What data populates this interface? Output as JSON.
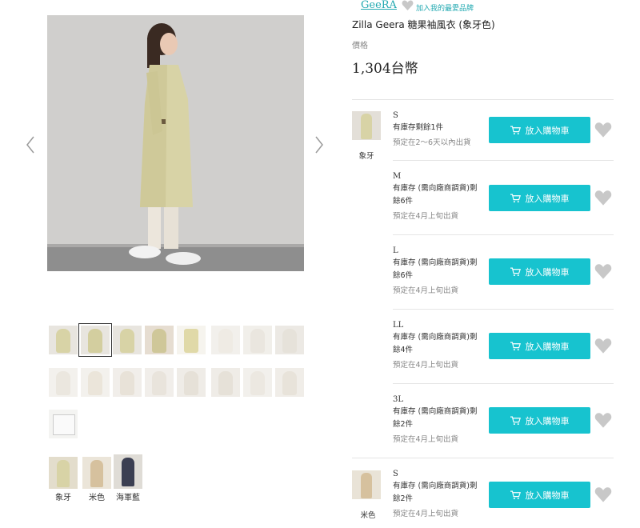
{
  "product": {
    "brand": "GeeRA",
    "favorite_text": "加入我的最愛品牌",
    "title": "Zilla Geera 糖果袖風衣 (象牙色)",
    "price_label": "價格",
    "price": "1,304台幣"
  },
  "gallery": {
    "prev_icon": "chevron-left-icon",
    "next_icon": "chevron-right-icon",
    "thumbnail_count": 17,
    "selected_thumbnail": 2
  },
  "colors": [
    {
      "label": "象牙",
      "swatch": "#e9e2c9"
    },
    {
      "label": "米色",
      "swatch": "#dcc8a6"
    },
    {
      "label": "海軍藍",
      "swatch": "#3b3f52"
    }
  ],
  "variants": [
    {
      "color": "象牙",
      "size": "S",
      "stock_line1": "有庫存剩餘1件",
      "stock_line2": "",
      "shipping": "預定在2～6天以內出貨",
      "button": "放入購物車"
    },
    {
      "color": "",
      "size": "M",
      "stock_line1": "有庫存 (需向廠商調貨)剩",
      "stock_line2": "餘6件",
      "shipping": "預定在4月上旬出貨",
      "button": "放入購物車"
    },
    {
      "color": "",
      "size": "L",
      "stock_line1": "有庫存 (需向廠商調貨)剩",
      "stock_line2": "餘6件",
      "shipping": "預定在4月上旬出貨",
      "button": "放入購物車"
    },
    {
      "color": "",
      "size": "LL",
      "stock_line1": "有庫存 (需向廠商調貨)剩",
      "stock_line2": "餘4件",
      "shipping": "預定在4月上旬出貨",
      "button": "放入購物車"
    },
    {
      "color": "",
      "size": "3L",
      "stock_line1": "有庫存 (需向廠商調貨)剩",
      "stock_line2": "餘2件",
      "shipping": "預定在4月上旬出貨",
      "button": "放入購物車"
    },
    {
      "color": "米色",
      "size": "S",
      "stock_line1": "有庫存 (需向廠商調貨)剩",
      "stock_line2": "餘2件",
      "shipping": "預定在4月上旬出貨",
      "button": "放入購物車"
    }
  ],
  "theme": {
    "accent": "#17c3cf",
    "link": "#20a8b0",
    "heart": "#c8c8c8"
  }
}
